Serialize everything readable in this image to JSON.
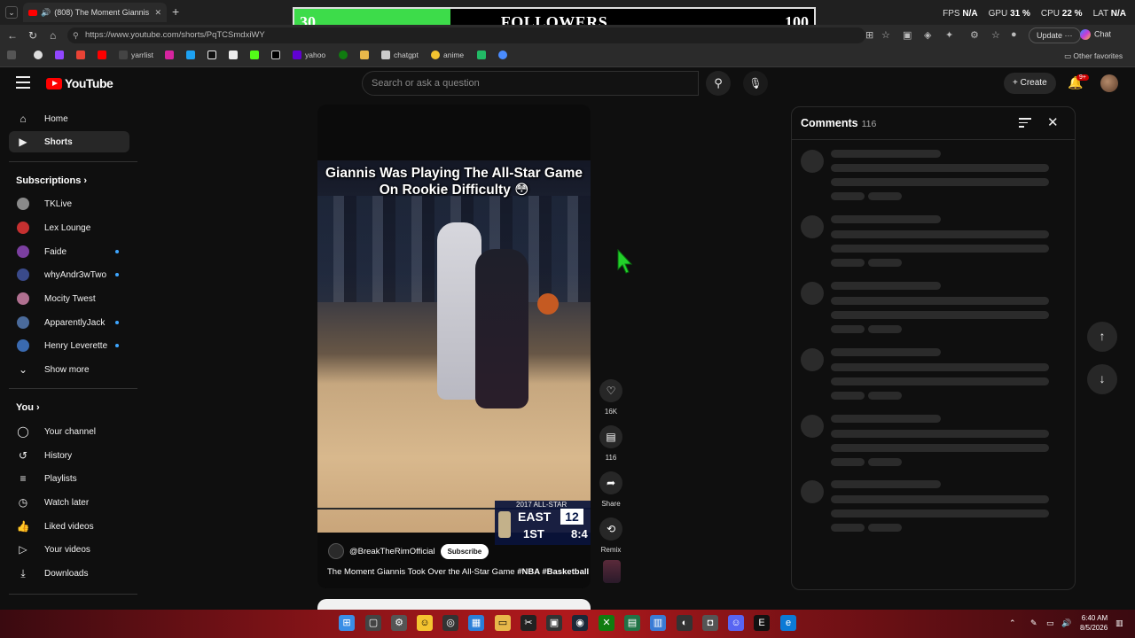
{
  "browser": {
    "tab_title": "(808) The Moment Giannis To",
    "url": "https://www.youtube.com/shorts/PqTCSmdxiWY",
    "update_label": "Update",
    "copilot_label": "Chat",
    "other_favorites": "Other favorites",
    "bookmarks": [
      "yarrlist",
      "yahoo",
      "chatgpt",
      "anime"
    ]
  },
  "overlay": {
    "followers_current": "30",
    "followers_label": "FOLLOWERS",
    "followers_goal": "100",
    "progress_fraction": 0.3,
    "fill_color": "#3ddc4a"
  },
  "perf": {
    "fps_label": "FPS",
    "fps_value": "N/A",
    "gpu_label": "GPU",
    "gpu_value": "31 %",
    "cpu_label": "CPU",
    "cpu_value": "22 %",
    "lat_label": "LAT",
    "lat_value": "N/A"
  },
  "youtube": {
    "logo_text": "YouTube",
    "search_placeholder": "Search or ask a question",
    "create_label": "Create",
    "notif_badge": "9+"
  },
  "sidebar": {
    "main": [
      {
        "label": "Home",
        "icon": "home-icon"
      },
      {
        "label": "Shorts",
        "icon": "shorts-icon",
        "active": true
      }
    ],
    "subscriptions_title": "Subscriptions",
    "subscriptions": [
      {
        "label": "TKLive",
        "dot": false,
        "color": "#8a8a8a"
      },
      {
        "label": "Lex Lounge",
        "dot": false,
        "color": "#c53030"
      },
      {
        "label": "Faide",
        "dot": true,
        "color": "#7b3fa0"
      },
      {
        "label": "whyAndr3wTwo",
        "dot": true,
        "color": "#3a4a8a"
      },
      {
        "label": "Mocity Twest",
        "dot": false,
        "color": "#b07090"
      },
      {
        "label": "ApparentlyJack",
        "dot": true,
        "color": "#4a6a9a"
      },
      {
        "label": "Henry Leverette",
        "dot": true,
        "color": "#3a6ab0"
      }
    ],
    "show_more": "Show more",
    "you_title": "You",
    "you_items": [
      {
        "label": "Your channel",
        "icon": "user-icon"
      },
      {
        "label": "History",
        "icon": "history-icon"
      },
      {
        "label": "Playlists",
        "icon": "playlist-icon"
      },
      {
        "label": "Watch later",
        "icon": "clock-icon"
      },
      {
        "label": "Liked videos",
        "icon": "thumbs-up-icon"
      },
      {
        "label": "Your videos",
        "icon": "play-square-icon"
      },
      {
        "label": "Downloads",
        "icon": "download-icon"
      }
    ]
  },
  "short": {
    "caption": "Giannis Was Playing The All-Star Game On Rookie Difficulty 😳",
    "scorebug_year": "2017 ALL-STAR",
    "scorebug_team": "EAST",
    "scorebug_score": "12",
    "scorebug_period": "1ST",
    "scorebug_clock": "8:4",
    "channel": "@BreakTheRimOfficial",
    "subscribe_label": "Subscribe",
    "title_text": "The Moment Giannis Took Over the All-Star Game",
    "hashtags": "#NBA #Basketball"
  },
  "actions": {
    "like_count": "16K",
    "comment_count": "116",
    "share_label": "Share",
    "remix_label": "Remix"
  },
  "comments": {
    "title": "Comments",
    "count": "116"
  },
  "taskbar": {
    "time": "6:40 AM",
    "date": "8/5/2026"
  }
}
